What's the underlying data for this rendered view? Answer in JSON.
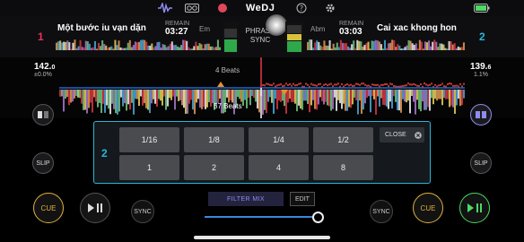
{
  "app": {
    "logo": "WeDJ"
  },
  "deck1": {
    "number": "1",
    "title": "Một bước iu vạn dặn",
    "remain_label": "REMAIN",
    "remain": "03:27",
    "key": "Em",
    "bpm_int": "142.",
    "bpm_dec": "0",
    "pitch": "±0.0%",
    "slip_label": "SLIP",
    "cue_label": "CUE",
    "sync_label": "SYNC"
  },
  "deck2": {
    "number": "2",
    "title": "Cai xac khong hon",
    "remain_label": "REMAIN",
    "remain": "03:03",
    "key": "Abm",
    "bpm_int": "139.",
    "bpm_dec": "6",
    "pitch": "1.1%",
    "slip_label": "SLIP",
    "cue_label": "CUE",
    "sync_label": "SYNC"
  },
  "phrase_sync": {
    "line1": "PHRASE",
    "line2": "SYNC"
  },
  "waveform": {
    "beats_top": "4 Beats",
    "beats_bottom": "57 Beats"
  },
  "pads": {
    "deck": "2",
    "close_label": "CLOSE",
    "row1": [
      "1/16",
      "1/8",
      "1/4",
      "1/2"
    ],
    "row2": [
      "1",
      "2",
      "4",
      "8"
    ]
  },
  "mixer": {
    "filter_label": "FILTER MIX",
    "edit_label": "EDIT",
    "crossfader": 0.97
  },
  "colors": {
    "accent": "#27b8d8",
    "cue": "#e2b13c",
    "play_active": "#4cd964",
    "filter": "#8e8cf0"
  }
}
